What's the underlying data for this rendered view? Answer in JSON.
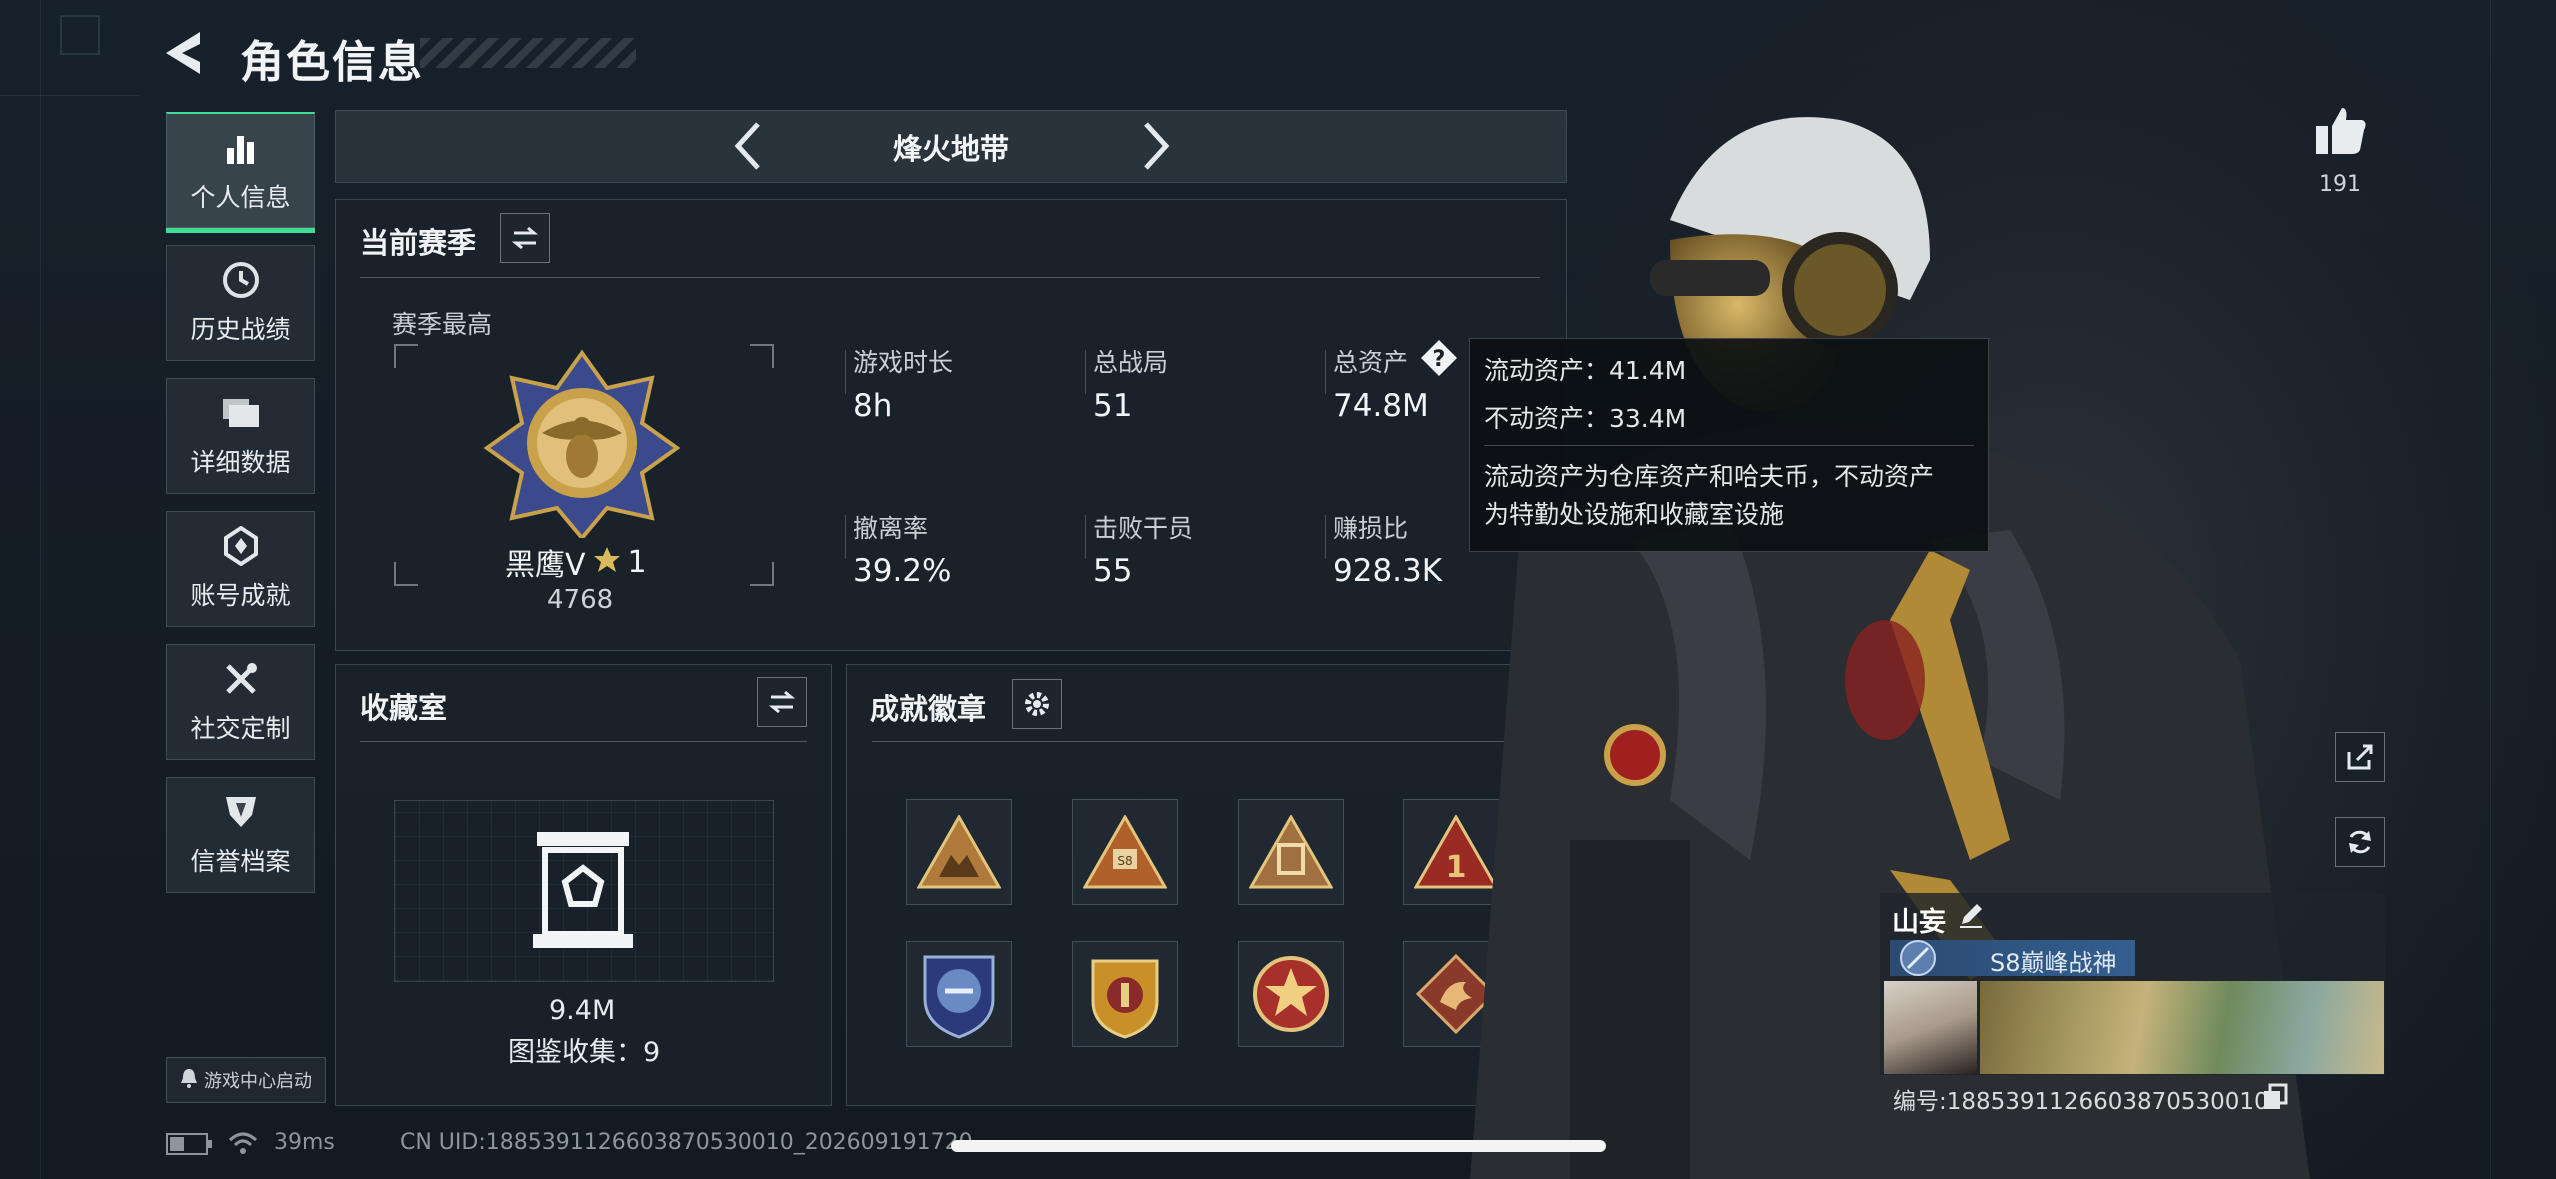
{
  "header": {
    "title": "角色信息"
  },
  "sidebar": {
    "items": [
      {
        "label": "个人信息",
        "icon": "bar-chart-icon",
        "active": true
      },
      {
        "label": "历史战绩",
        "icon": "clock-icon",
        "active": false
      },
      {
        "label": "详细数据",
        "icon": "folder-icon",
        "active": false
      },
      {
        "label": "账号成就",
        "icon": "achievement-icon",
        "active": false
      },
      {
        "label": "社交定制",
        "icon": "tools-icon",
        "active": false
      },
      {
        "label": "信誉档案",
        "icon": "shield-icon",
        "active": false
      }
    ],
    "launch_label": "游戏中心启动"
  },
  "mode": {
    "label": "烽火地带"
  },
  "season": {
    "title": "当前赛季",
    "best_label": "赛季最高",
    "rank_name": "黑鹰V",
    "rank_stars": "1",
    "rank_points": "4768",
    "stats": [
      {
        "label": "游戏时长",
        "value": "8h"
      },
      {
        "label": "总战局",
        "value": "51"
      },
      {
        "label": "总资产",
        "value": "74.8M"
      },
      {
        "label": "撤离率",
        "value": "39.2%"
      },
      {
        "label": "击败干员",
        "value": "55"
      },
      {
        "label": "赚损比",
        "value": "928.3K"
      }
    ]
  },
  "tooltip": {
    "line1": "流动资产：41.4M",
    "line2": "不动资产：33.4M",
    "desc1": "流动资产为仓库资产和哈夫币，不动资产",
    "desc2": "为特勤处设施和收藏室设施"
  },
  "collection": {
    "title": "收藏室",
    "value": "9.4M",
    "count_label": "图鉴收集：9"
  },
  "badges": {
    "title": "成就徽章",
    "items": [
      "triangle-beast-badge",
      "triangle-s8-badge",
      "triangle-gate-badge",
      "triangle-one-badge",
      "blue-shield-badge",
      "gold-shield-badge",
      "red-star-badge",
      "dragon-diamond-badge"
    ]
  },
  "character": {
    "likes": "191",
    "player_name": "山妄",
    "title": "S8巅峰战神",
    "card_id": "编号:1885391126603870530010"
  },
  "status_bar": {
    "ping": "39ms",
    "uid": "CN UID:1885391126603870530010_202609191720"
  },
  "colors": {
    "accent": "#3ddc97",
    "gold": "#c9a14a",
    "title_blue": "#345f8f"
  }
}
